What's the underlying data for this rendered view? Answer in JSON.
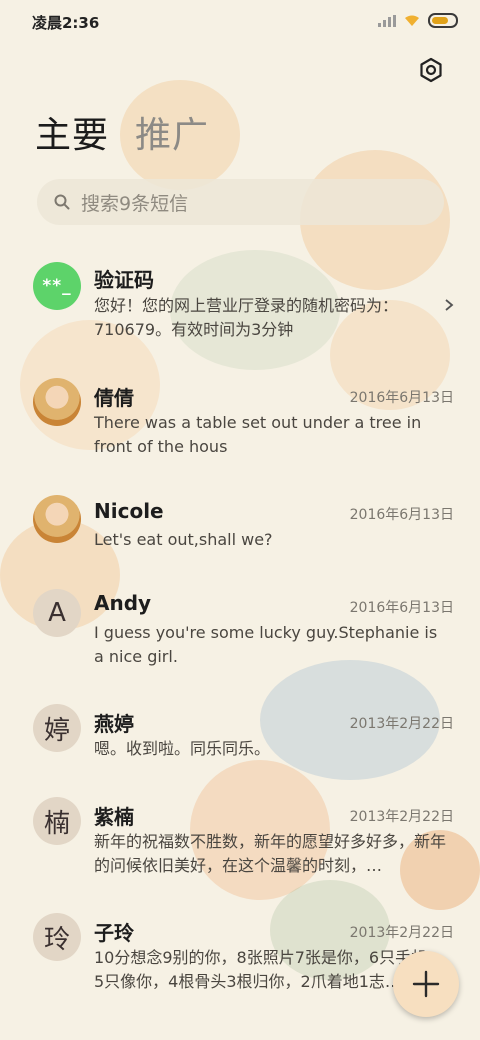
{
  "status_bar": {
    "time": "凌晨2:36"
  },
  "tabs": [
    {
      "label": "主要",
      "active": true
    },
    {
      "label": "推广",
      "active": false
    }
  ],
  "search": {
    "placeholder": "搜索9条短信"
  },
  "conversations": [
    {
      "avatar_text": "**_",
      "avatar_type": "green",
      "name": "验证码",
      "date": "",
      "snippet": "您好！您的网上营业厅登录的随机密码为：710679。有效时间为3分钟",
      "has_chevron": true
    },
    {
      "avatar_text": "",
      "avatar_type": "photo",
      "name": "倩倩",
      "date": "2016年6月13日",
      "snippet": "There was a table set out under a tree in front of the hous"
    },
    {
      "avatar_text": "",
      "avatar_type": "photo",
      "name": "Nicole",
      "date": "2016年6月13日",
      "snippet": "Let's eat out,shall we?"
    },
    {
      "avatar_text": "A",
      "avatar_type": "letter",
      "name": "Andy",
      "date": "2016年6月13日",
      "snippet": "I guess you're some lucky guy.Stephanie is a nice girl."
    },
    {
      "avatar_text": "婷",
      "avatar_type": "letter",
      "name": "燕婷",
      "date": "2013年2月22日",
      "snippet": "嗯。收到啦。同乐同乐。"
    },
    {
      "avatar_text": "楠",
      "avatar_type": "letter",
      "name": "紫楠",
      "date": "2013年2月22日",
      "snippet": "新年的祝福数不胜数，新年的愿望好多好多，新年的问候依旧美好，在这个温馨的时刻，…"
    },
    {
      "avatar_text": "玲",
      "avatar_type": "letter",
      "name": "子玲",
      "date": "2013年2月22日",
      "snippet": "10分想念9别的你，8张照片7张是你，6只手机5只像你，4根骨头3根归你，2爪着地1志…"
    }
  ],
  "fab": {
    "icon": "plus-icon"
  },
  "colors": {
    "accent_green": "#5dd36a",
    "background": "#f6f1e4",
    "fab": "#f7dfc0"
  }
}
